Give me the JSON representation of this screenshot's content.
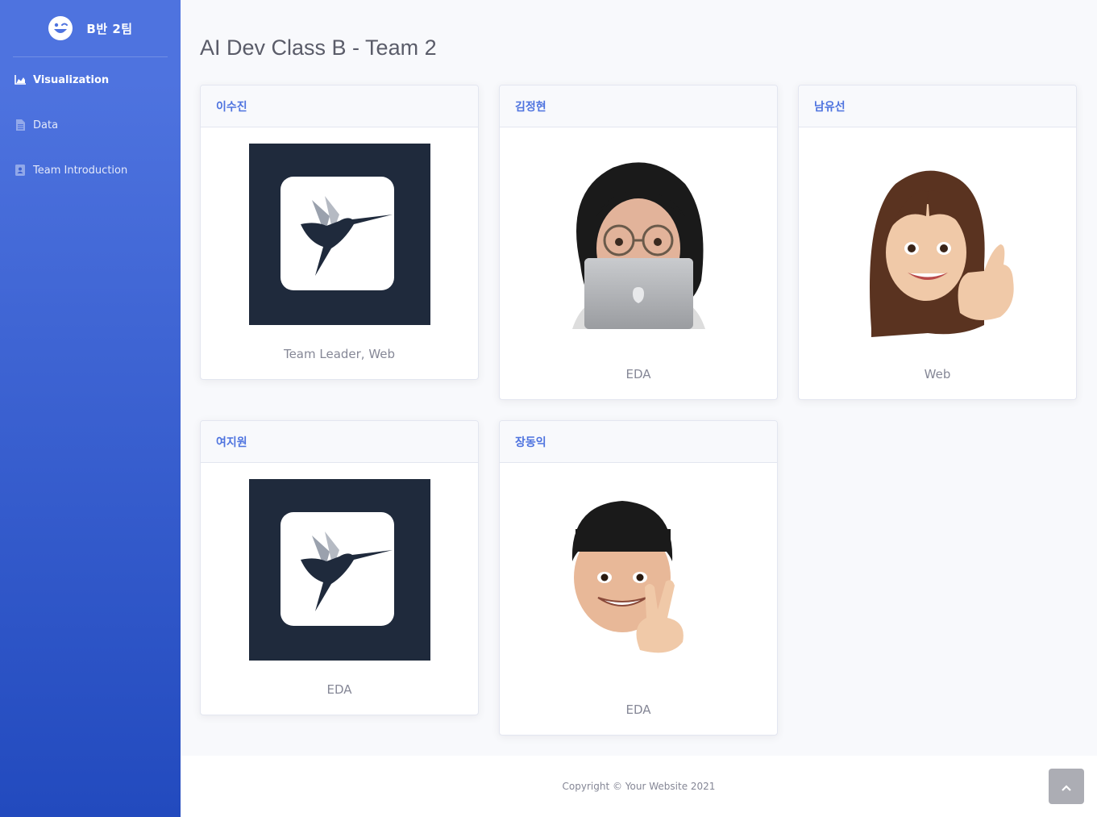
{
  "sidebar": {
    "brand": "B반 2팀",
    "items": [
      {
        "label": "Visualization",
        "icon": "chart-area-icon",
        "active": true
      },
      {
        "label": "Data",
        "icon": "file-icon",
        "active": false
      },
      {
        "label": "Team Introduction",
        "icon": "address-book-icon",
        "active": false
      }
    ]
  },
  "main": {
    "title": "AI Dev Class B - Team 2",
    "members": [
      {
        "name": "이수진",
        "role": "Team Leader, Web",
        "image": "hummingbird-logo"
      },
      {
        "name": "김정현",
        "role": "EDA",
        "image": "memoji-laptop"
      },
      {
        "name": "남유선",
        "role": "Web",
        "image": "memoji-thumbs-up"
      },
      {
        "name": "여지원",
        "role": "EDA",
        "image": "hummingbird-logo"
      },
      {
        "name": "장동익",
        "role": "EDA",
        "image": "memoji-peace"
      }
    ]
  },
  "footer": {
    "copyright": "Copyright © Your Website 2021"
  },
  "colors": {
    "primary": "#4e73df",
    "sidebar_end": "#224abe",
    "logo_bg": "#1f2a3c"
  }
}
